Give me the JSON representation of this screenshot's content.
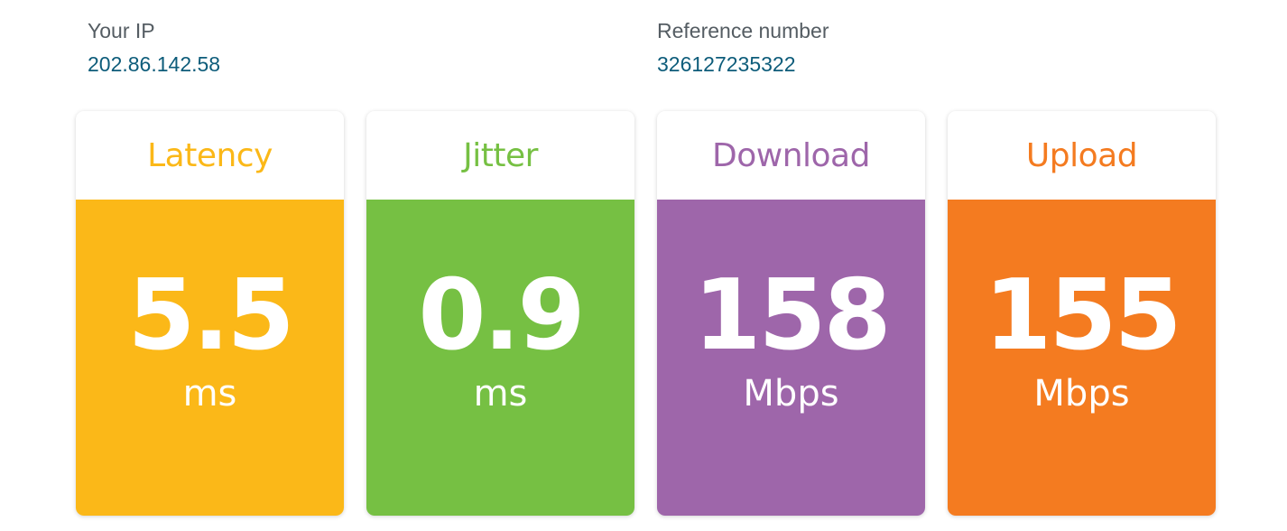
{
  "info": {
    "ip_label": "Your IP",
    "ip_value": "202.86.142.58",
    "ref_label": "Reference number",
    "ref_value": "326127235322"
  },
  "cards": [
    {
      "title": "Latency",
      "value": "5.5",
      "unit": "ms",
      "color": "#fbb818"
    },
    {
      "title": "Jitter",
      "value": "0.9",
      "unit": "ms",
      "color": "#76c043"
    },
    {
      "title": "Download",
      "value": "158",
      "unit": "Mbps",
      "color": "#9e66aa"
    },
    {
      "title": "Upload",
      "value": "155",
      "unit": "Mbps",
      "color": "#f47b20"
    }
  ]
}
